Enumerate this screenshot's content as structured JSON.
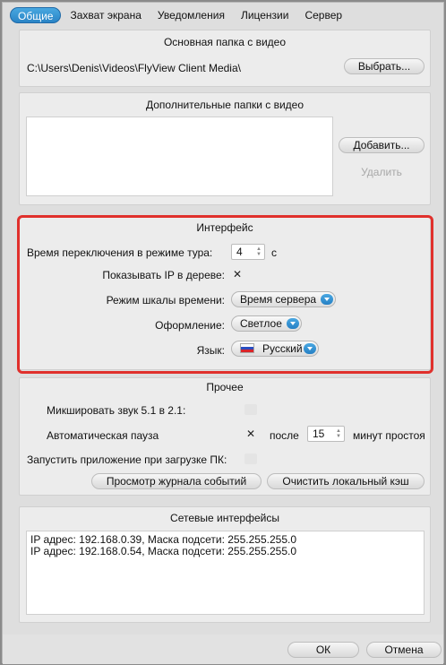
{
  "tabs": [
    "Общие",
    "Захват экрана",
    "Уведомления",
    "Лицензии",
    "Сервер"
  ],
  "main_folder": {
    "title": "Основная папка с видео",
    "path": "C:\\Users\\Denis\\Videos\\FlyView Client Media\\",
    "browse_label": "Выбрать..."
  },
  "extra_folders": {
    "title": "Дополнительные  папки с видео",
    "add_label": "Добавить...",
    "remove_label": "Удалить"
  },
  "interface": {
    "title": "Интерфейс",
    "tour_label": "Время переключения в режиме тура:",
    "tour_value": "4",
    "tour_unit": "с",
    "show_ip_label": "Показывать IP в дереве:",
    "show_ip_mark": "✕",
    "timeline_label": "Режим шкалы времени:",
    "timeline_value": "Время сервера",
    "theme_label": "Оформление:",
    "theme_value": "Светлое",
    "lang_label": "Язык:",
    "lang_value": "Русский"
  },
  "other": {
    "title": "Прочее",
    "mix_label": "Микшировать звук 5.1 в 2.1:",
    "autopause_label": "Автоматическая пауза",
    "autopause_mark": "✕",
    "after_label": "после",
    "after_value": "15",
    "minutes_label": "минут простоя",
    "autostart_label": "Запустить приложение при загрузке ПК:",
    "log_label": "Просмотр журнала событий",
    "clear_cache_label": "Очистить локальный кэш"
  },
  "network": {
    "title": "Сетевые интерфейсы",
    "lines": [
      "IP адрес: 192.168.0.39, Маска подсети: 255.255.255.0",
      "IP адрес: 192.168.0.54, Маска подсети: 255.255.255.0"
    ]
  },
  "footer": {
    "ok_label": "ОК",
    "cancel_label": "Отмена"
  },
  "colors": {
    "accent": "#2a84c6",
    "highlight": "#e0302c"
  }
}
